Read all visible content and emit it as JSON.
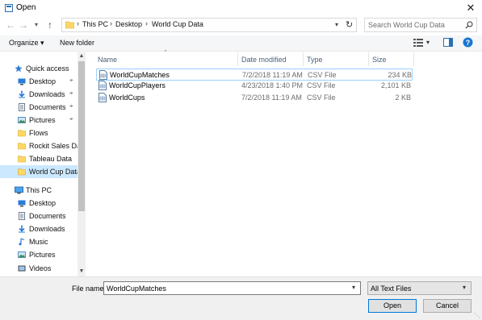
{
  "window": {
    "title": "Open",
    "close_glyph": "✕"
  },
  "breadcrumb": {
    "items": [
      "This PC",
      "Desktop",
      "World Cup Data"
    ],
    "sep": "›"
  },
  "search": {
    "placeholder": "Search World Cup Data"
  },
  "toolbar": {
    "organize": "Organize ▾",
    "new_folder": "New folder"
  },
  "nav": {
    "items": [
      {
        "label": "Quick access",
        "icon": "star-icon"
      },
      {
        "label": "Desktop",
        "icon": "desktop-icon",
        "pinned": true
      },
      {
        "label": "Downloads",
        "icon": "download-icon",
        "pinned": true
      },
      {
        "label": "Documents",
        "icon": "documents-icon",
        "pinned": true
      },
      {
        "label": "Pictures",
        "icon": "pictures-icon",
        "pinned": true
      },
      {
        "label": "Flows",
        "icon": "folder-icon"
      },
      {
        "label": "Rockit Sales Data",
        "icon": "folder-icon"
      },
      {
        "label": "Tableau Data",
        "icon": "folder-icon"
      },
      {
        "label": "World Cup Data",
        "icon": "folder-icon",
        "selected": true
      },
      {
        "label": "This PC",
        "icon": "computer-icon"
      },
      {
        "label": "Desktop",
        "icon": "desktop-icon"
      },
      {
        "label": "Documents",
        "icon": "documents-icon"
      },
      {
        "label": "Downloads",
        "icon": "download-icon"
      },
      {
        "label": "Music",
        "icon": "music-icon"
      },
      {
        "label": "Pictures",
        "icon": "pictures-icon"
      },
      {
        "label": "Videos",
        "icon": "videos-icon"
      }
    ]
  },
  "columns": {
    "name": "Name",
    "date": "Date modified",
    "type": "Type",
    "size": "Size"
  },
  "files": [
    {
      "name": "WorldCupMatches",
      "date": "7/2/2018 11:19 AM",
      "type": "CSV File",
      "size": "234 KB",
      "selected": true
    },
    {
      "name": "WorldCupPlayers",
      "date": "4/23/2018 1:40 PM",
      "type": "CSV File",
      "size": "2,101 KB"
    },
    {
      "name": "WorldCups",
      "date": "7/2/2018 11:19 AM",
      "type": "CSV File",
      "size": "2 KB"
    }
  ],
  "footer": {
    "filename_label": "File name:",
    "filename_value": "WorldCupMatches",
    "filter_value": "All Text Files",
    "open_label": "Open",
    "cancel_label": "Cancel"
  },
  "colors": {
    "accent": "#0078d7",
    "selection": "#cce8ff",
    "folder": "#ffd863"
  }
}
